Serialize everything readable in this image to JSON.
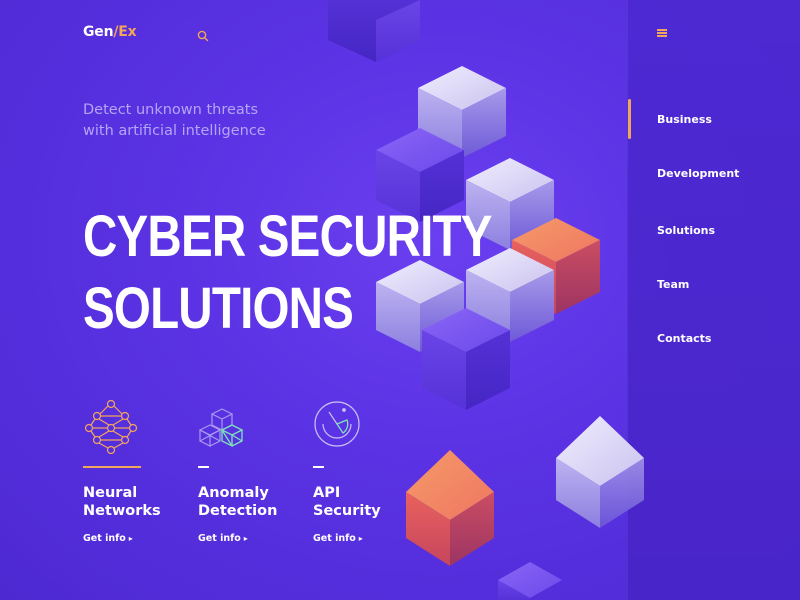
{
  "header": {
    "logo_part1": "Gen",
    "logo_slash": "/",
    "logo_part2": "Ex",
    "search_icon": "search-icon",
    "menu_icon": "hamburger-menu-icon"
  },
  "hero": {
    "tagline_line1": "Detect unknown threats",
    "tagline_line2": "with artificial intelligence",
    "title_line1": "CYBER SECURITY",
    "title_line2": "SOLUTIONS"
  },
  "features": [
    {
      "icon": "neural-network-icon",
      "name": "Neural\nNetworks",
      "link": "Get info",
      "active": true
    },
    {
      "icon": "cubes-icon",
      "name": "Anomaly\nDetection",
      "link": "Get info",
      "active": false
    },
    {
      "icon": "radar-icon",
      "name": "API\nSecurity",
      "link": "Get info",
      "active": false
    }
  ],
  "sidebar": {
    "items": [
      {
        "label": "Business",
        "active": true
      },
      {
        "label": "Development",
        "active": false
      },
      {
        "label": "Solutions",
        "active": false
      },
      {
        "label": "Team",
        "active": false
      },
      {
        "label": "Contacts",
        "active": false
      }
    ]
  },
  "colors": {
    "background": "#5a32e3",
    "accent": "#f4a55c",
    "tagline": "#b4a5f7",
    "icon_green": "#7fe3b8"
  }
}
